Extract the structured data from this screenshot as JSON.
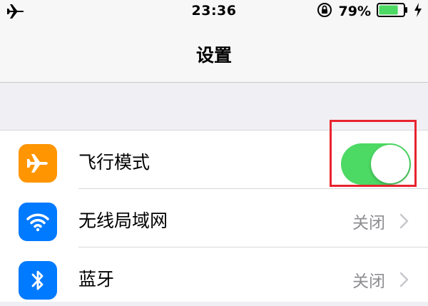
{
  "status_bar": {
    "time": "23:36",
    "battery_percent": "79%",
    "battery_level": 0.79,
    "mode_icon": "airplane-icon",
    "orientation_lock_icon": "orientation-lock-icon",
    "charging_icon": "charging-bolt-icon"
  },
  "nav": {
    "title": "设置"
  },
  "settings": {
    "rows": [
      {
        "label": "飞行模式",
        "icon": "airplane-icon",
        "icon_color": "#ff9500",
        "control": "toggle",
        "toggle_on": true
      },
      {
        "label": "无线局域网",
        "icon": "wifi-icon",
        "icon_color": "#007aff",
        "value": "关闭"
      },
      {
        "label": "蓝牙",
        "icon": "bluetooth-icon",
        "icon_color": "#007aff",
        "value": "关闭"
      }
    ]
  },
  "colors": {
    "toggle_on": "#4cd964",
    "highlight": "#e8232e",
    "secondary_text": "#8e8e93"
  }
}
